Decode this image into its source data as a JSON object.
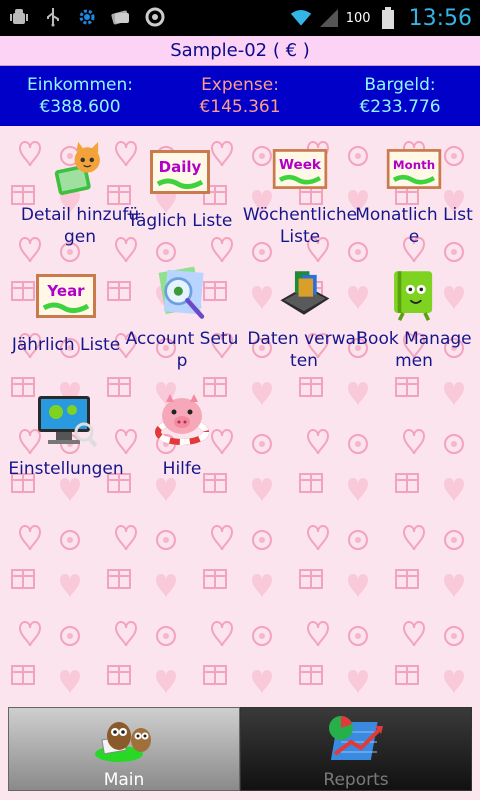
{
  "status_bar": {
    "battery_text": "100",
    "time": "13:56"
  },
  "title": "Sample-02 ( € )",
  "summary": {
    "income_label": "Einkommen:",
    "income_value": "€388.600",
    "expense_label": "Expense:",
    "expense_value": "€145.361",
    "cash_label": "Bargeld:",
    "cash_value": "€233.776"
  },
  "grid": {
    "items": [
      {
        "label": "Detail hinzufügen",
        "icon": "cat-add-icon"
      },
      {
        "label": "Täglich Liste",
        "icon": "daily-calendar-icon",
        "icon_text": "Daily"
      },
      {
        "label": "Wöchentliche Liste",
        "icon": "week-calendar-icon",
        "icon_text": "Week"
      },
      {
        "label": "Monatlich Liste",
        "icon": "month-calendar-icon",
        "icon_text": "Month"
      },
      {
        "label": "Jährlich Liste",
        "icon": "year-calendar-icon",
        "icon_text": "Year"
      },
      {
        "label": "Account Setup",
        "icon": "account-setup-icon"
      },
      {
        "label": "Daten verwalten",
        "icon": "data-manage-icon"
      },
      {
        "label": "Book Managemen",
        "icon": "book-icon"
      },
      {
        "label": "Einstellungen",
        "icon": "settings-monitor-icon"
      },
      {
        "label": "Hilfe",
        "icon": "piggy-help-icon"
      }
    ]
  },
  "tabs": {
    "main_label": "Main",
    "reports_label": "Reports"
  },
  "colors": {
    "summary_bg": "#0000c8",
    "title_bg": "#fdd3f5",
    "status_time": "#33b5e5"
  }
}
